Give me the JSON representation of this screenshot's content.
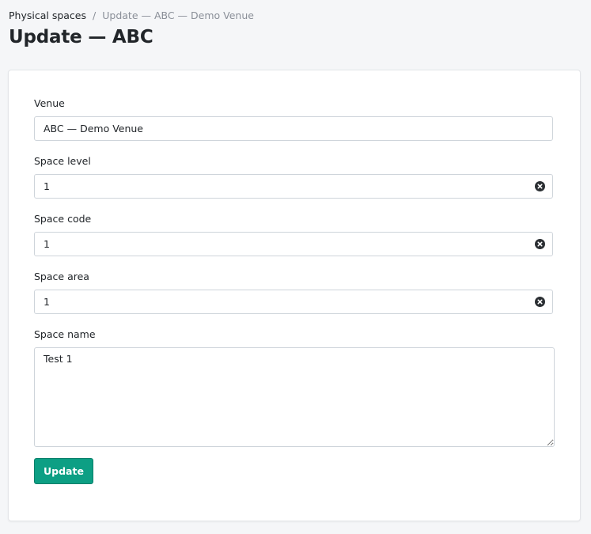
{
  "breadcrumb": {
    "parent": "Physical spaces",
    "separator": "/",
    "current": "Update — ABC — Demo Venue"
  },
  "page_title": "Update — ABC",
  "form": {
    "venue": {
      "label": "Venue",
      "value": "ABC — Demo Venue"
    },
    "space_level": {
      "label": "Space level",
      "value": "1"
    },
    "space_code": {
      "label": "Space code",
      "value": "1"
    },
    "space_area": {
      "label": "Space area",
      "value": "1"
    },
    "space_name": {
      "label": "Space name",
      "value": "Test 1"
    },
    "submit_label": "Update"
  },
  "colors": {
    "primary_button": "#0d9f84",
    "background": "#f5f6f8",
    "card": "#ffffff"
  },
  "icons": {
    "clear": "close-circle-icon"
  }
}
